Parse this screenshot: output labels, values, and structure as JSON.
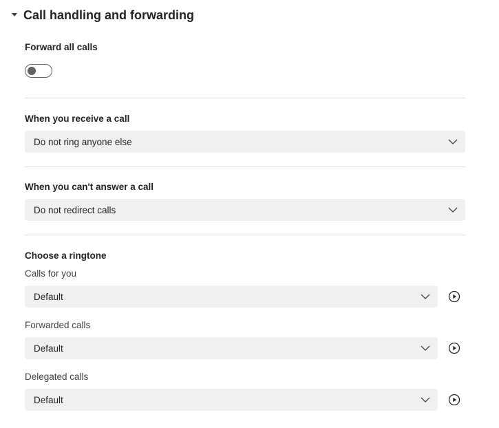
{
  "section": {
    "title": "Call handling and forwarding",
    "expanded": true,
    "caret_icon": "caret-down-icon"
  },
  "forward_all": {
    "label": "Forward all calls",
    "enabled": false
  },
  "receive_call": {
    "label": "When you receive a call",
    "selected": "Do not ring anyone else"
  },
  "cant_answer": {
    "label": "When you can't answer a call",
    "selected": "Do not redirect calls"
  },
  "ringtone": {
    "heading": "Choose a ringtone",
    "calls_for_you": {
      "label": "Calls for you",
      "selected": "Default"
    },
    "forwarded_calls": {
      "label": "Forwarded calls",
      "selected": "Default"
    },
    "delegated_calls": {
      "label": "Delegated calls",
      "selected": "Default"
    },
    "play_icon": "play-circle-icon"
  },
  "colors": {
    "text": "#242424",
    "dropdown_bg": "#f0f0f0",
    "divider": "#e0e0e0",
    "toggle_off": "#616161"
  }
}
